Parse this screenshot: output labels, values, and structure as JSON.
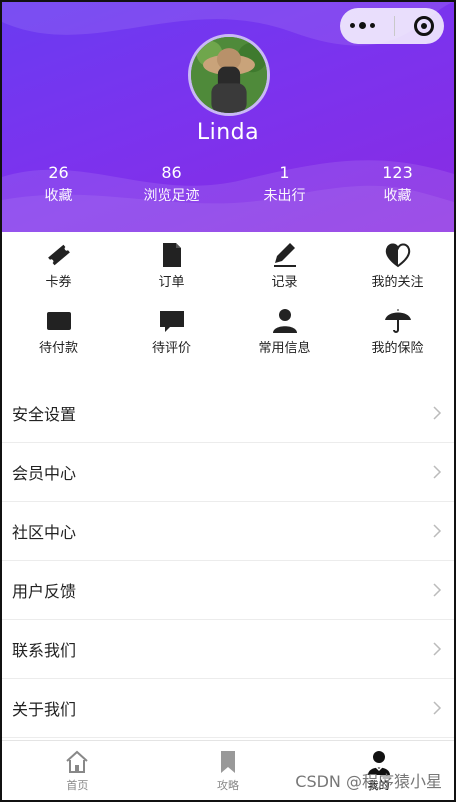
{
  "profile": {
    "username": "Linda",
    "stats": [
      {
        "value": "26",
        "label": "收藏"
      },
      {
        "value": "86",
        "label": "浏览足迹"
      },
      {
        "value": "1",
        "label": "未出行"
      },
      {
        "value": "123",
        "label": "收藏"
      }
    ]
  },
  "capsule": {
    "menu_icon": "more-dots-icon",
    "close_icon": "close-target-icon"
  },
  "shortcuts": [
    {
      "label": "卡券",
      "icon": "ticket-icon"
    },
    {
      "label": "订单",
      "icon": "order-icon"
    },
    {
      "label": "记录",
      "icon": "pen-icon"
    },
    {
      "label": "我的关注",
      "icon": "heart-icon"
    },
    {
      "label": "待付款",
      "icon": "card-icon"
    },
    {
      "label": "待评价",
      "icon": "comment-icon"
    },
    {
      "label": "常用信息",
      "icon": "person-icon"
    },
    {
      "label": "我的保险",
      "icon": "umbrella-icon"
    }
  ],
  "menu": [
    {
      "label": "安全设置"
    },
    {
      "label": "会员中心"
    },
    {
      "label": "社区中心"
    },
    {
      "label": "用户反馈"
    },
    {
      "label": "联系我们"
    },
    {
      "label": "关于我们"
    }
  ],
  "tabbar": [
    {
      "label": "首页",
      "icon": "home-icon",
      "active": false
    },
    {
      "label": "攻略",
      "icon": "bookmark-icon",
      "active": false
    },
    {
      "label": "我的",
      "icon": "user-icon",
      "active": true
    }
  ],
  "watermark": "CSDN @程序猿小星",
  "colors": {
    "header_start": "#6a3bf1",
    "header_end": "#8a2be2",
    "icon": "#222222"
  }
}
